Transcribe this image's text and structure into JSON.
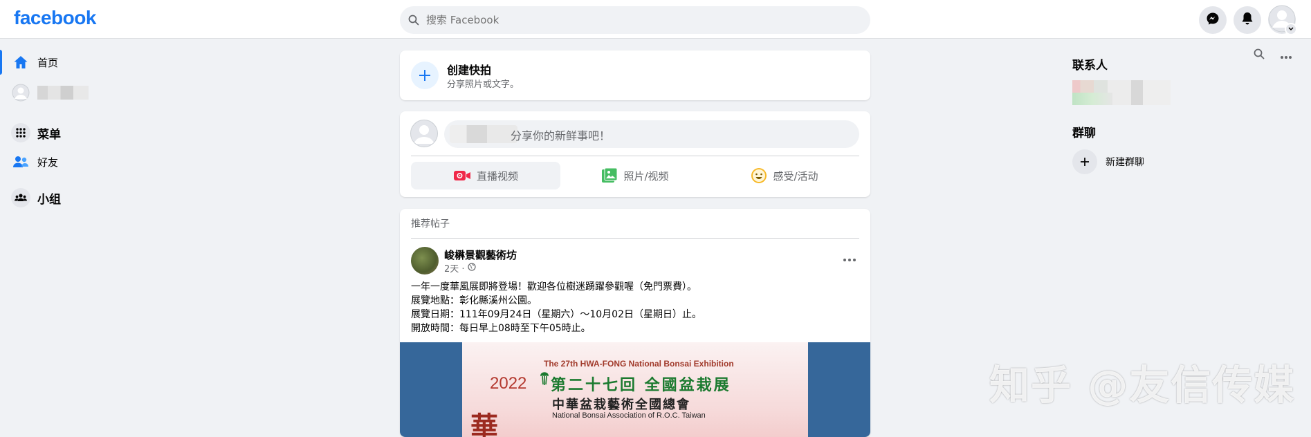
{
  "header": {
    "logo": "facebook",
    "search_placeholder": "搜索 Facebook",
    "icons": [
      "messenger-icon",
      "notifications-icon",
      "account-avatar"
    ]
  },
  "sidebar": {
    "items": [
      {
        "label": "首页",
        "icon": "home-icon",
        "active": true
      },
      {
        "label": "",
        "icon": "profile-avatar"
      },
      {
        "label": "菜单",
        "icon": "menu-grid-icon"
      },
      {
        "label": "好友",
        "icon": "friends-icon"
      },
      {
        "label": "小组",
        "icon": "groups-icon"
      }
    ]
  },
  "story": {
    "title": "创建快拍",
    "subtitle": "分享照片或文字。"
  },
  "composer": {
    "placeholder": "分享你的新鲜事吧！",
    "actions": [
      {
        "label": "直播视频",
        "icon": "live-video-icon"
      },
      {
        "label": "照片/视频",
        "icon": "photo-video-icon"
      },
      {
        "label": "感受/活动",
        "icon": "feeling-icon"
      }
    ]
  },
  "post": {
    "section_label": "推荐帖子",
    "author": "峻楙景觀藝術坊",
    "time": "2天 ·",
    "lines": [
      "一年一度華風展即將登場！歡迎各位樹迷踴躍參觀喔（免門票費）。",
      "展覽地點：彰化縣溪州公園。",
      "展覽日期：111年09月24日（星期六）～10月02日（星期日）止。",
      "開放時間：每日早上08時至下午05時止。"
    ],
    "poster": {
      "english_title": "The 27th HWA-FONG National Bonsai Exhibition",
      "year": "2022",
      "chinese_title": "第二十七回 全國盆栽展",
      "org": "中華盆栽藝術全國總會",
      "org_english": "National Bonsai Association of R.O.C. Taiwan",
      "calligraphy": "華"
    }
  },
  "right_panel": {
    "contacts_title": "联系人",
    "group_chat_title": "群聊",
    "new_group_label": "新建群聊"
  },
  "watermark": "知乎 @友信传媒",
  "colors": {
    "brand": "#1877f2",
    "background": "#f0f2f5",
    "live": "#f02849",
    "photo": "#45bd62",
    "feeling": "#f7b928"
  }
}
